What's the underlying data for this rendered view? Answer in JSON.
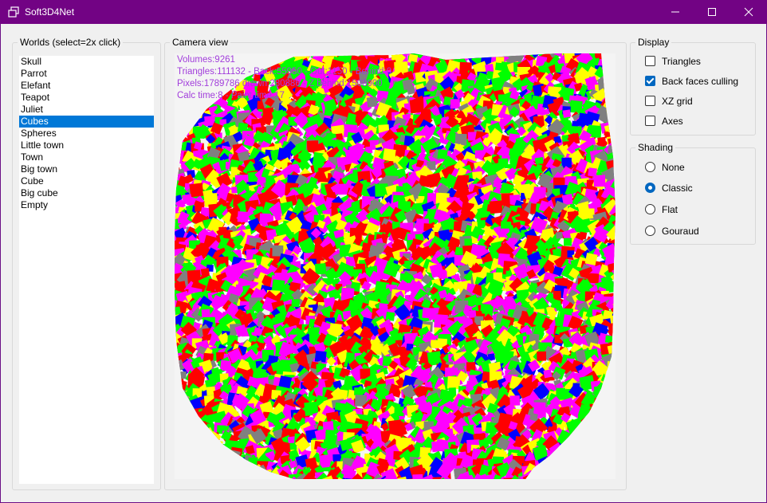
{
  "window": {
    "title": "Soft3D4Net"
  },
  "worlds": {
    "legend": "Worlds (select=2x click)",
    "items": [
      "Skull",
      "Parrot",
      "Elefant",
      "Teapot",
      "Juliet",
      "Cubes",
      "Spheres",
      "Little town",
      "Town",
      "Big town",
      "Cube",
      "Big cube",
      "Empty"
    ],
    "selected": "Cubes"
  },
  "camera": {
    "legend": "Camera view",
    "stats": [
      "Volumes:9261",
      "Triangles:111132 - Back:55950 - Out:1150 - Behind:0",
      "Pixels:1789786 drawn:280886 - Z behind:1508900",
      "Calc time:8 - Paint time:17"
    ],
    "stats_color": "#a13ddb",
    "cube_colors": [
      "#ff00ff",
      "#00ff00",
      "#ff0000",
      "#ffff00",
      "#0000ff",
      "#808080"
    ]
  },
  "display": {
    "legend": "Display",
    "options": [
      {
        "label": "Triangles",
        "checked": false
      },
      {
        "label": "Back faces culling",
        "checked": true
      },
      {
        "label": "XZ grid",
        "checked": false
      },
      {
        "label": "Axes",
        "checked": false
      }
    ]
  },
  "shading": {
    "legend": "Shading",
    "options": [
      {
        "label": "None",
        "selected": false
      },
      {
        "label": "Classic",
        "selected": true
      },
      {
        "label": "Flat",
        "selected": false
      },
      {
        "label": "Gouraud",
        "selected": false
      }
    ]
  }
}
